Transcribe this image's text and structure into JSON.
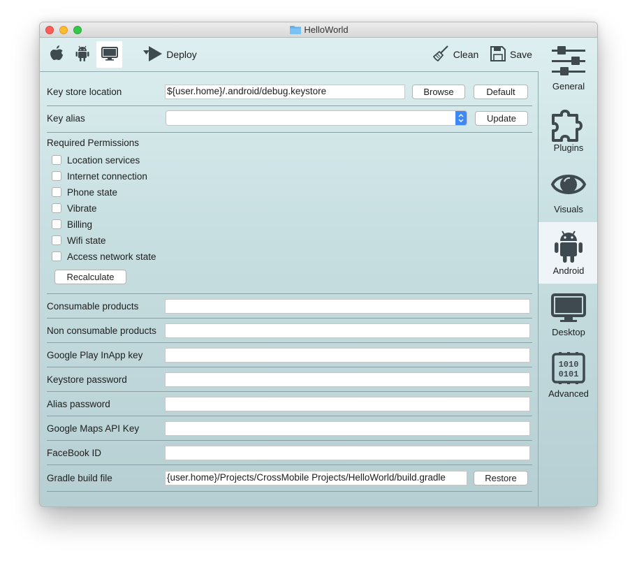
{
  "window": {
    "title": "HelloWorld"
  },
  "toolbar": {
    "platforms": [
      {
        "name": "apple-icon",
        "selected": false
      },
      {
        "name": "android-icon",
        "selected": false
      },
      {
        "name": "desktop-icon",
        "selected": true
      }
    ],
    "deploy_label": "Deploy",
    "clean_label": "Clean",
    "save_label": "Save"
  },
  "sidebar": {
    "items": [
      {
        "label": "General",
        "icon": "sliders-icon",
        "selected": false
      },
      {
        "label": "Plugins",
        "icon": "puzzle-icon",
        "selected": false
      },
      {
        "label": "Visuals",
        "icon": "eye-icon",
        "selected": false
      },
      {
        "label": "Android",
        "icon": "android-icon",
        "selected": true
      },
      {
        "label": "Desktop",
        "icon": "monitor-icon",
        "selected": false
      },
      {
        "label": "Advanced",
        "icon": "binary-chip-icon",
        "selected": false
      }
    ],
    "advanced_chip_text": [
      "1010",
      "0101"
    ]
  },
  "form": {
    "keystore": {
      "label": "Key store location",
      "value": "${user.home}/.android/debug.keystore",
      "browse": "Browse",
      "default": "Default"
    },
    "alias": {
      "label": "Key alias",
      "value": "",
      "update": "Update"
    },
    "permissions": {
      "title": "Required Permissions",
      "items": [
        {
          "label": "Location services",
          "checked": false
        },
        {
          "label": "Internet connection",
          "checked": false
        },
        {
          "label": "Phone state",
          "checked": false
        },
        {
          "label": "Vibrate",
          "checked": false
        },
        {
          "label": "Billing",
          "checked": false
        },
        {
          "label": "Wifi state",
          "checked": false
        },
        {
          "label": "Access network state",
          "checked": false
        }
      ],
      "recalculate": "Recalculate"
    },
    "fields": [
      {
        "label": "Consumable products",
        "value": ""
      },
      {
        "label": "Non consumable products",
        "value": ""
      },
      {
        "label": "Google Play InApp key",
        "value": ""
      },
      {
        "label": "Keystore password",
        "value": ""
      },
      {
        "label": "Alias password",
        "value": ""
      },
      {
        "label": "Google Maps API Key",
        "value": ""
      },
      {
        "label": "FaceBook ID",
        "value": ""
      }
    ],
    "gradle": {
      "label": "Gradle build file",
      "value": "{user.home}/Projects/CrossMobile Projects/HelloWorld/build.gradle",
      "restore": "Restore"
    }
  }
}
